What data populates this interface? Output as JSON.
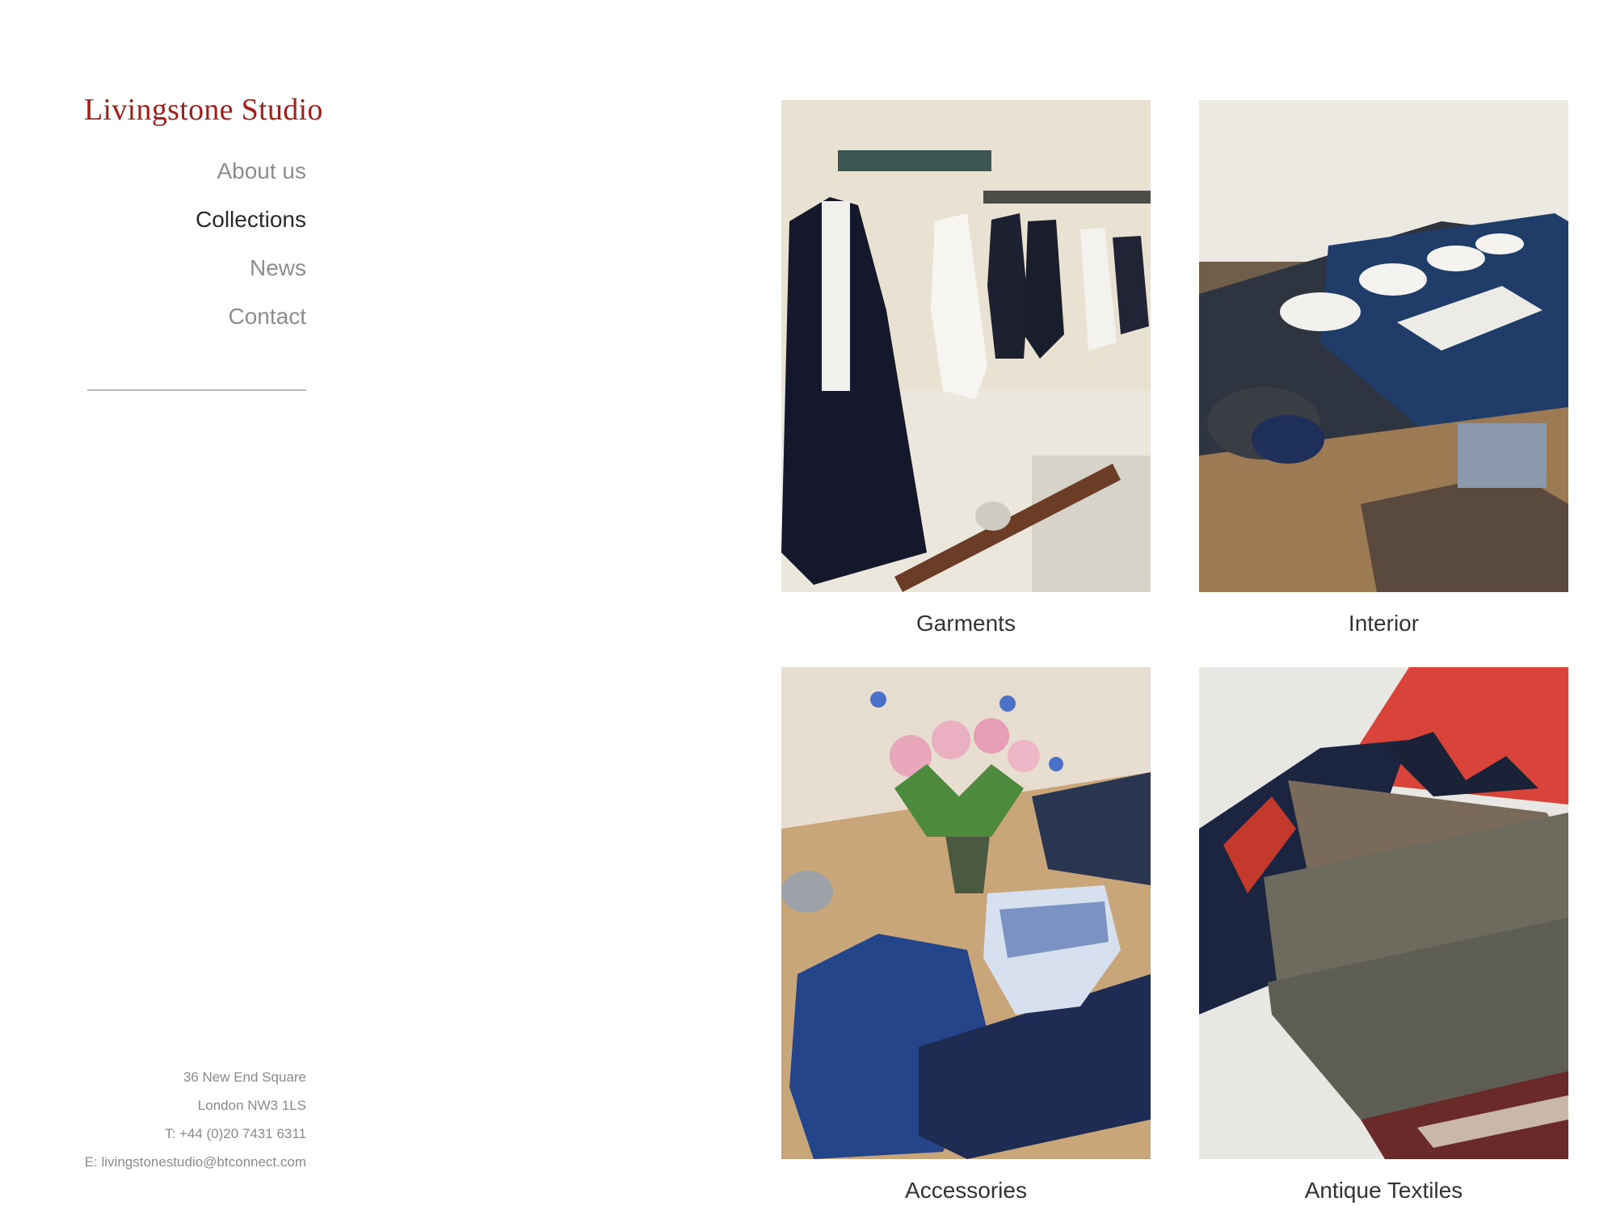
{
  "site": {
    "title": "Livingstone Studio",
    "brand_color": "#a21f1a"
  },
  "nav": {
    "items": [
      {
        "label": "About us",
        "active": false
      },
      {
        "label": "Collections",
        "active": true
      },
      {
        "label": "News",
        "active": false
      },
      {
        "label": "Contact",
        "active": false
      }
    ]
  },
  "contact": {
    "address_line1": "36 New End Square",
    "address_line2": "London NW3 1LS",
    "phone": "T: +44 (0)20 7431 6311",
    "email": "E: livingstonestudio@btconnect.com"
  },
  "collections": [
    {
      "label": "Garments"
    },
    {
      "label": "Interior"
    },
    {
      "label": "Accessories"
    },
    {
      "label": "Antique Textiles"
    }
  ]
}
